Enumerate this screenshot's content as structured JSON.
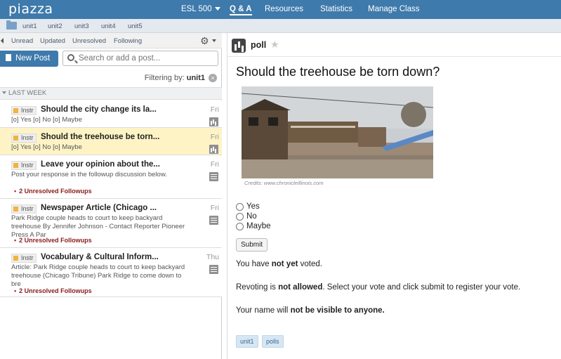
{
  "app": {
    "logo": "piazza"
  },
  "nav": {
    "class_name": "ESL 500",
    "items": [
      "Q & A",
      "Resources",
      "Statistics",
      "Manage Class"
    ]
  },
  "folders": [
    "unit1",
    "unit2",
    "unit3",
    "unit4",
    "unit5"
  ],
  "filters": [
    "Unread",
    "Updated",
    "Unresolved",
    "Following"
  ],
  "new_post_label": "New Post",
  "search": {
    "placeholder": "Search or add a post..."
  },
  "filtering": {
    "label": "Filtering by:",
    "value": "unit1"
  },
  "section": "LAST WEEK",
  "posts": [
    {
      "tag": "Instr",
      "title": "Should the city change its la...",
      "snippet": "[o] Yes [o] No [o] Maybe",
      "followups": "",
      "day": "Fri",
      "icon": "poll-icon"
    },
    {
      "tag": "Instr",
      "title": "Should the treehouse be torn...",
      "snippet": "[o] Yes [o] No [o] Maybe",
      "followups": "",
      "day": "Fri",
      "icon": "poll-icon"
    },
    {
      "tag": "Instr",
      "title": "Leave your opinion about the...",
      "snippet": "Post your response in the followup discussion below.",
      "followups": "2 Unresolved Followups",
      "day": "Fri",
      "icon": "note-icon"
    },
    {
      "tag": "Instr",
      "title": "Newspaper Article (Chicago ...",
      "snippet": "Park Ridge couple heads to court to keep backyard treehouse By Jennifer Johnson - Contact Reporter Pioneer Press A Par",
      "followups": "2 Unresolved Followups",
      "day": "Fri",
      "icon": "note-icon"
    },
    {
      "tag": "Instr",
      "title": "Vocabulary & Cultural Inform...",
      "snippet": "Article: Park Ridge couple heads to court to keep backyard treehouse (Chicago Tribune) Park Ridge to come down to bre",
      "followups": "2 Unresolved Followups",
      "day": "Thu",
      "icon": "note-icon"
    }
  ],
  "poll": {
    "type_label": "poll",
    "question": "Should the treehouse be torn down?",
    "credits": "Credits: www.chronicleillinois.com",
    "options": [
      "Yes",
      "No",
      "Maybe"
    ],
    "submit_label": "Submit",
    "vote_status": {
      "pre": "You have ",
      "bold": "not yet",
      "post": " voted."
    },
    "revote": {
      "pre": "Revoting is ",
      "bold": "not allowed",
      "post": ". Select your vote and click submit to register your vote."
    },
    "visibility": {
      "pre": "Your name will ",
      "bold": "not be visible to anyone.",
      "post": ""
    },
    "tags": [
      "unit1",
      "polls"
    ]
  },
  "colors": {
    "header": "#3e7aab",
    "selected_row": "#fdf3c5",
    "followup": "#8a1b1b",
    "tag_bg": "#d6e6f2"
  }
}
